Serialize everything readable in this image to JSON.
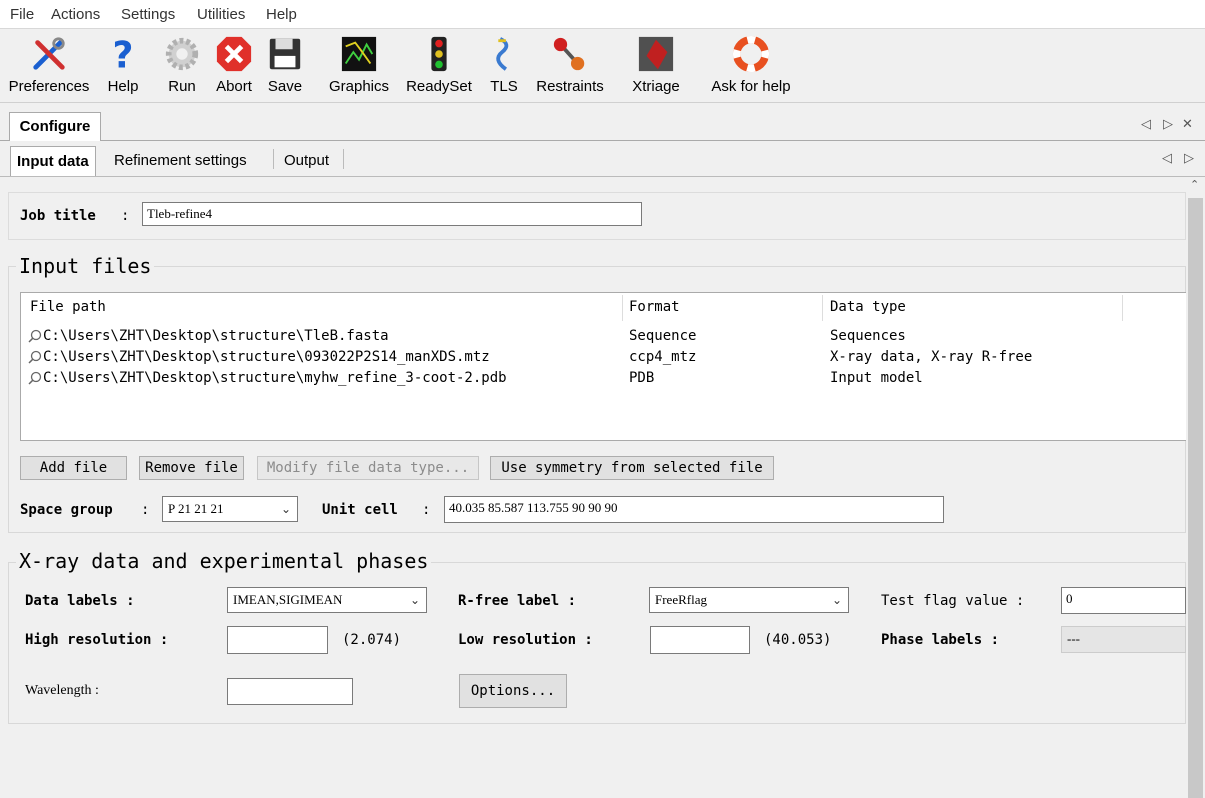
{
  "menu": [
    "File",
    "Actions",
    "Settings",
    "Utilities",
    "Help"
  ],
  "toolbar": {
    "preferences": "Preferences",
    "help": "Help",
    "run": "Run",
    "abort": "Abort",
    "save": "Save",
    "graphics": "Graphics",
    "readyset": "ReadySet",
    "tls": "TLS",
    "restraints": "Restraints",
    "xtriage": "Xtriage",
    "ask_for_help": "Ask for help"
  },
  "tabs_top": {
    "configure": "Configure"
  },
  "corner_controls": {
    "left": "◁",
    "right": "▷",
    "close": "✕"
  },
  "tabs_sub": {
    "input_data": "Input data",
    "refinement_settings": "Refinement settings",
    "output": "Output"
  },
  "job": {
    "label": "Job title",
    "colon": ":",
    "value": "Tleb-refine4"
  },
  "input_files": {
    "title": "Input files",
    "headers": {
      "path": "File path",
      "format": "Format",
      "type": "Data type"
    },
    "rows": [
      {
        "path": "C:\\Users\\ZHT\\Desktop\\structure\\TleB.fasta",
        "format": "Sequence",
        "type": "Sequences"
      },
      {
        "path": "C:\\Users\\ZHT\\Desktop\\structure\\093022P2S14_manXDS.mtz",
        "format": "ccp4_mtz",
        "type": "X-ray data, X-ray R-free"
      },
      {
        "path": "C:\\Users\\ZHT\\Desktop\\structure\\myhw_refine_3-coot-2.pdb",
        "format": "PDB",
        "type": "Input model"
      }
    ],
    "buttons": {
      "add": "Add file",
      "remove": "Remove file",
      "modify": "Modify file data type...",
      "symmetry": "Use symmetry from selected file"
    }
  },
  "symmetry": {
    "space_group_label": "Space group",
    "space_group": "P 21 21 21",
    "unit_cell_label": "Unit cell",
    "unit_cell": "40.035 85.587 113.755 90 90 90"
  },
  "xray": {
    "title": "X-ray data and experimental phases",
    "data_labels_label": "Data labels :",
    "data_labels": "IMEAN,SIGIMEAN",
    "rfree_label_label": "R-free label :",
    "rfree_label": "FreeRflag",
    "test_flag_label": "Test flag value :",
    "test_flag": "0",
    "high_res_label": "High resolution :",
    "high_res_hint": "(2.074)",
    "low_res_label": "Low resolution :",
    "low_res_hint": "(40.053)",
    "phase_labels_label": "Phase labels :",
    "phase_labels": "---",
    "wavelength_label": "Wavelength :",
    "options": "Options..."
  },
  "colors": {
    "error_red": "#e0302a",
    "help_blue": "#1a5fd0",
    "menu_bg": "#ffffff",
    "panel_bg": "#f0f0f0"
  }
}
